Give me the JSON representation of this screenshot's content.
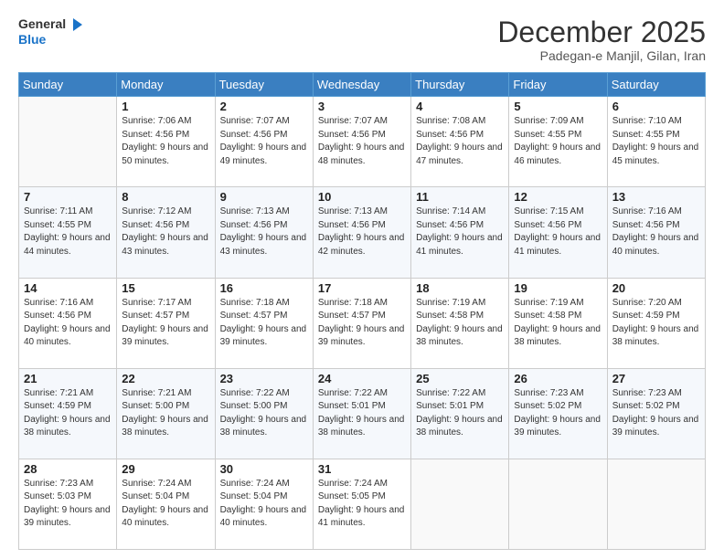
{
  "header": {
    "logo_line1": "General",
    "logo_line2": "Blue",
    "month_title": "December 2025",
    "location": "Padegan-e Manjil, Gilan, Iran"
  },
  "weekdays": [
    "Sunday",
    "Monday",
    "Tuesday",
    "Wednesday",
    "Thursday",
    "Friday",
    "Saturday"
  ],
  "weeks": [
    [
      {
        "day": "",
        "sunrise": "",
        "sunset": "",
        "daylight": ""
      },
      {
        "day": "1",
        "sunrise": "Sunrise: 7:06 AM",
        "sunset": "Sunset: 4:56 PM",
        "daylight": "Daylight: 9 hours and 50 minutes."
      },
      {
        "day": "2",
        "sunrise": "Sunrise: 7:07 AM",
        "sunset": "Sunset: 4:56 PM",
        "daylight": "Daylight: 9 hours and 49 minutes."
      },
      {
        "day": "3",
        "sunrise": "Sunrise: 7:07 AM",
        "sunset": "Sunset: 4:56 PM",
        "daylight": "Daylight: 9 hours and 48 minutes."
      },
      {
        "day": "4",
        "sunrise": "Sunrise: 7:08 AM",
        "sunset": "Sunset: 4:56 PM",
        "daylight": "Daylight: 9 hours and 47 minutes."
      },
      {
        "day": "5",
        "sunrise": "Sunrise: 7:09 AM",
        "sunset": "Sunset: 4:55 PM",
        "daylight": "Daylight: 9 hours and 46 minutes."
      },
      {
        "day": "6",
        "sunrise": "Sunrise: 7:10 AM",
        "sunset": "Sunset: 4:55 PM",
        "daylight": "Daylight: 9 hours and 45 minutes."
      }
    ],
    [
      {
        "day": "7",
        "sunrise": "Sunrise: 7:11 AM",
        "sunset": "Sunset: 4:55 PM",
        "daylight": "Daylight: 9 hours and 44 minutes."
      },
      {
        "day": "8",
        "sunrise": "Sunrise: 7:12 AM",
        "sunset": "Sunset: 4:56 PM",
        "daylight": "Daylight: 9 hours and 43 minutes."
      },
      {
        "day": "9",
        "sunrise": "Sunrise: 7:13 AM",
        "sunset": "Sunset: 4:56 PM",
        "daylight": "Daylight: 9 hours and 43 minutes."
      },
      {
        "day": "10",
        "sunrise": "Sunrise: 7:13 AM",
        "sunset": "Sunset: 4:56 PM",
        "daylight": "Daylight: 9 hours and 42 minutes."
      },
      {
        "day": "11",
        "sunrise": "Sunrise: 7:14 AM",
        "sunset": "Sunset: 4:56 PM",
        "daylight": "Daylight: 9 hours and 41 minutes."
      },
      {
        "day": "12",
        "sunrise": "Sunrise: 7:15 AM",
        "sunset": "Sunset: 4:56 PM",
        "daylight": "Daylight: 9 hours and 41 minutes."
      },
      {
        "day": "13",
        "sunrise": "Sunrise: 7:16 AM",
        "sunset": "Sunset: 4:56 PM",
        "daylight": "Daylight: 9 hours and 40 minutes."
      }
    ],
    [
      {
        "day": "14",
        "sunrise": "Sunrise: 7:16 AM",
        "sunset": "Sunset: 4:56 PM",
        "daylight": "Daylight: 9 hours and 40 minutes."
      },
      {
        "day": "15",
        "sunrise": "Sunrise: 7:17 AM",
        "sunset": "Sunset: 4:57 PM",
        "daylight": "Daylight: 9 hours and 39 minutes."
      },
      {
        "day": "16",
        "sunrise": "Sunrise: 7:18 AM",
        "sunset": "Sunset: 4:57 PM",
        "daylight": "Daylight: 9 hours and 39 minutes."
      },
      {
        "day": "17",
        "sunrise": "Sunrise: 7:18 AM",
        "sunset": "Sunset: 4:57 PM",
        "daylight": "Daylight: 9 hours and 39 minutes."
      },
      {
        "day": "18",
        "sunrise": "Sunrise: 7:19 AM",
        "sunset": "Sunset: 4:58 PM",
        "daylight": "Daylight: 9 hours and 38 minutes."
      },
      {
        "day": "19",
        "sunrise": "Sunrise: 7:19 AM",
        "sunset": "Sunset: 4:58 PM",
        "daylight": "Daylight: 9 hours and 38 minutes."
      },
      {
        "day": "20",
        "sunrise": "Sunrise: 7:20 AM",
        "sunset": "Sunset: 4:59 PM",
        "daylight": "Daylight: 9 hours and 38 minutes."
      }
    ],
    [
      {
        "day": "21",
        "sunrise": "Sunrise: 7:21 AM",
        "sunset": "Sunset: 4:59 PM",
        "daylight": "Daylight: 9 hours and 38 minutes."
      },
      {
        "day": "22",
        "sunrise": "Sunrise: 7:21 AM",
        "sunset": "Sunset: 5:00 PM",
        "daylight": "Daylight: 9 hours and 38 minutes."
      },
      {
        "day": "23",
        "sunrise": "Sunrise: 7:22 AM",
        "sunset": "Sunset: 5:00 PM",
        "daylight": "Daylight: 9 hours and 38 minutes."
      },
      {
        "day": "24",
        "sunrise": "Sunrise: 7:22 AM",
        "sunset": "Sunset: 5:01 PM",
        "daylight": "Daylight: 9 hours and 38 minutes."
      },
      {
        "day": "25",
        "sunrise": "Sunrise: 7:22 AM",
        "sunset": "Sunset: 5:01 PM",
        "daylight": "Daylight: 9 hours and 38 minutes."
      },
      {
        "day": "26",
        "sunrise": "Sunrise: 7:23 AM",
        "sunset": "Sunset: 5:02 PM",
        "daylight": "Daylight: 9 hours and 39 minutes."
      },
      {
        "day": "27",
        "sunrise": "Sunrise: 7:23 AM",
        "sunset": "Sunset: 5:02 PM",
        "daylight": "Daylight: 9 hours and 39 minutes."
      }
    ],
    [
      {
        "day": "28",
        "sunrise": "Sunrise: 7:23 AM",
        "sunset": "Sunset: 5:03 PM",
        "daylight": "Daylight: 9 hours and 39 minutes."
      },
      {
        "day": "29",
        "sunrise": "Sunrise: 7:24 AM",
        "sunset": "Sunset: 5:04 PM",
        "daylight": "Daylight: 9 hours and 40 minutes."
      },
      {
        "day": "30",
        "sunrise": "Sunrise: 7:24 AM",
        "sunset": "Sunset: 5:04 PM",
        "daylight": "Daylight: 9 hours and 40 minutes."
      },
      {
        "day": "31",
        "sunrise": "Sunrise: 7:24 AM",
        "sunset": "Sunset: 5:05 PM",
        "daylight": "Daylight: 9 hours and 41 minutes."
      },
      {
        "day": "",
        "sunrise": "",
        "sunset": "",
        "daylight": ""
      },
      {
        "day": "",
        "sunrise": "",
        "sunset": "",
        "daylight": ""
      },
      {
        "day": "",
        "sunrise": "",
        "sunset": "",
        "daylight": ""
      }
    ]
  ]
}
